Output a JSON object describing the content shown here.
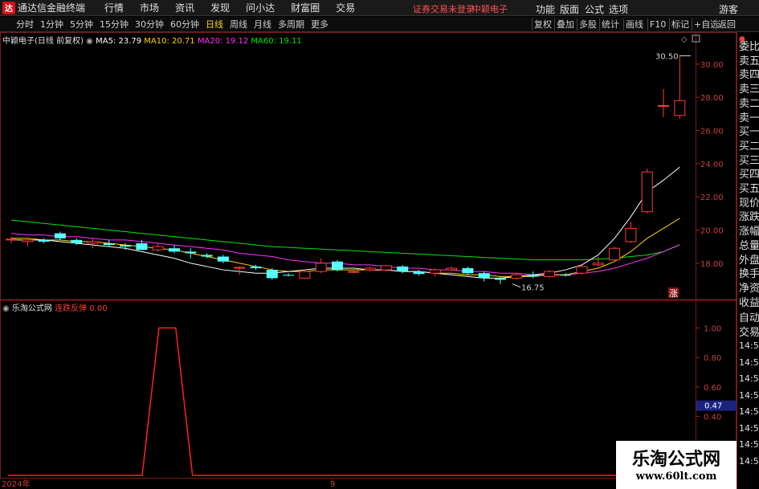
{
  "app_title": "通达信金融终端",
  "menus": [
    "行情",
    "市场",
    "资讯",
    "发现",
    "问小达",
    "财富圈",
    "交易"
  ],
  "login_warning": "证券交易未登录",
  "stock_name_top": "中颖电子",
  "right_menus": [
    "功能",
    "版面",
    "公式",
    "选项",
    "游客"
  ],
  "toolbar": {
    "periods": [
      "分时",
      "1分钟",
      "5分钟",
      "15分钟",
      "30分钟",
      "60分钟",
      "日线",
      "周线",
      "月线",
      "多周期",
      "更多"
    ],
    "active": "日线",
    "right_buttons": [
      "复权",
      "叠加",
      "多股",
      "统计",
      "画线",
      "F10",
      "标记",
      "+自选",
      "返回"
    ]
  },
  "main_legend": {
    "title": "中颖电子(日线 前复权)",
    "ma5": "MA5: 23.79",
    "ma10": "MA10: 20.71",
    "ma20": "MA20: 19.12",
    "ma60": "MA60: 19.11"
  },
  "sub_legend": {
    "title": "乐淘公式网",
    "indicator": "连跌反弹",
    "value": "0.00"
  },
  "annotations": {
    "high": "30.50",
    "low": "16.75",
    "rise_badge": "涨"
  },
  "right_panel": {
    "labels": [
      "委比",
      "卖五",
      "卖四",
      "卖三",
      "卖二",
      "卖一",
      "买一",
      "买二",
      "买三",
      "买四",
      "买五",
      "现价",
      "涨跌",
      "涨幅",
      "总量",
      "外盘",
      "换手",
      "净资",
      "收益",
      "自动",
      "交易"
    ],
    "times": [
      "14:56",
      "14:56",
      "14:56",
      "14:56",
      "14:56",
      "14:56",
      "14:56",
      "14:56"
    ]
  },
  "time_axis": [
    "2024年",
    "9"
  ],
  "sub_value_tag": "0.47",
  "watermark": {
    "line1": "乐淘公式网",
    "line2": "www.60lt.com"
  },
  "colors": {
    "up": "#ff3c3c",
    "down": "#54ffff",
    "ma5": "#ffffff",
    "ma10": "#ffd200",
    "ma20": "#ff32ff",
    "ma60": "#00e600",
    "indicator": "#ff2020"
  },
  "chart_data": [
    {
      "type": "candlestick",
      "y_ticks": [
        18.0,
        20.0,
        22.0,
        24.0,
        26.0,
        28.0,
        30.0
      ],
      "ylim": [
        16.2,
        31.2
      ],
      "candles": [
        {
          "o": 19.4,
          "h": 19.6,
          "l": 19.2,
          "c": 19.45
        },
        {
          "o": 19.3,
          "h": 19.55,
          "l": 19.0,
          "c": 19.4
        },
        {
          "o": 19.4,
          "h": 19.5,
          "l": 19.2,
          "c": 19.3
        },
        {
          "o": 19.8,
          "h": 19.9,
          "l": 19.4,
          "c": 19.5
        },
        {
          "o": 19.4,
          "h": 19.5,
          "l": 19.1,
          "c": 19.2
        },
        {
          "o": 19.2,
          "h": 19.5,
          "l": 18.9,
          "c": 19.3
        },
        {
          "o": 19.2,
          "h": 19.4,
          "l": 19.0,
          "c": 19.1
        },
        {
          "o": 19.1,
          "h": 19.2,
          "l": 18.8,
          "c": 19.0
        },
        {
          "o": 19.2,
          "h": 19.4,
          "l": 18.9,
          "c": 18.8
        },
        {
          "o": 18.8,
          "h": 19.2,
          "l": 18.7,
          "c": 19.0
        },
        {
          "o": 18.9,
          "h": 19.1,
          "l": 18.6,
          "c": 18.7
        },
        {
          "o": 18.7,
          "h": 18.9,
          "l": 18.3,
          "c": 18.6
        },
        {
          "o": 18.5,
          "h": 18.6,
          "l": 18.3,
          "c": 18.4
        },
        {
          "o": 18.4,
          "h": 18.5,
          "l": 18.0,
          "c": 18.1
        },
        {
          "o": 17.7,
          "h": 17.8,
          "l": 17.3,
          "c": 17.75
        },
        {
          "o": 17.8,
          "h": 17.9,
          "l": 17.6,
          "c": 17.7
        },
        {
          "o": 17.6,
          "h": 17.7,
          "l": 17.0,
          "c": 17.1
        },
        {
          "o": 17.3,
          "h": 17.4,
          "l": 17.2,
          "c": 17.25
        },
        {
          "o": 17.1,
          "h": 17.6,
          "l": 17.05,
          "c": 17.5
        },
        {
          "o": 17.5,
          "h": 18.3,
          "l": 17.4,
          "c": 18.0
        },
        {
          "o": 18.1,
          "h": 18.2,
          "l": 17.5,
          "c": 17.6
        },
        {
          "o": 17.5,
          "h": 17.6,
          "l": 17.4,
          "c": 17.5
        },
        {
          "o": 17.6,
          "h": 17.8,
          "l": 17.5,
          "c": 17.7
        },
        {
          "o": 17.6,
          "h": 17.9,
          "l": 17.5,
          "c": 17.85
        },
        {
          "o": 17.8,
          "h": 17.9,
          "l": 17.4,
          "c": 17.5
        },
        {
          "o": 17.5,
          "h": 17.6,
          "l": 17.25,
          "c": 17.35
        },
        {
          "o": 17.4,
          "h": 17.7,
          "l": 17.2,
          "c": 17.6
        },
        {
          "o": 17.6,
          "h": 17.8,
          "l": 17.5,
          "c": 17.7
        },
        {
          "o": 17.7,
          "h": 17.8,
          "l": 17.3,
          "c": 17.4
        },
        {
          "o": 17.4,
          "h": 17.5,
          "l": 16.9,
          "c": 17.1
        },
        {
          "o": 17.1,
          "h": 17.2,
          "l": 16.75,
          "c": 17.0
        },
        {
          "o": 17.1,
          "h": 17.4,
          "l": 17.0,
          "c": 17.3
        },
        {
          "o": 17.3,
          "h": 17.5,
          "l": 17.1,
          "c": 17.2
        },
        {
          "o": 17.2,
          "h": 17.6,
          "l": 17.1,
          "c": 17.5
        },
        {
          "o": 17.3,
          "h": 17.4,
          "l": 17.2,
          "c": 17.25
        },
        {
          "o": 17.4,
          "h": 17.9,
          "l": 17.3,
          "c": 17.8
        },
        {
          "o": 17.9,
          "h": 18.4,
          "l": 17.8,
          "c": 18.0
        },
        {
          "o": 18.2,
          "h": 19.0,
          "l": 18.1,
          "c": 18.9
        },
        {
          "o": 19.3,
          "h": 20.5,
          "l": 19.2,
          "c": 20.1
        },
        {
          "o": 21.1,
          "h": 23.7,
          "l": 21.0,
          "c": 23.5
        },
        {
          "o": 27.5,
          "h": 28.5,
          "l": 26.8,
          "c": 27.5
        },
        {
          "o": 26.9,
          "h": 30.5,
          "l": 26.7,
          "c": 27.8
        }
      ],
      "ma60": [
        20.6,
        20.5,
        20.4,
        20.3,
        20.2,
        20.1,
        20.0,
        19.9,
        19.8,
        19.7,
        19.6,
        19.5,
        19.4,
        19.3,
        19.2,
        19.1,
        19.0,
        18.95,
        18.9,
        18.85,
        18.8,
        18.75,
        18.7,
        18.65,
        18.6,
        18.55,
        18.5,
        18.45,
        18.4,
        18.35,
        18.3,
        18.25,
        18.2,
        18.2,
        18.2,
        18.2,
        18.25,
        18.3,
        18.4,
        18.5,
        18.7,
        19.11
      ],
      "ma20": [
        19.8,
        19.7,
        19.7,
        19.6,
        19.6,
        19.5,
        19.4,
        19.4,
        19.3,
        19.2,
        19.1,
        19.0,
        18.9,
        18.8,
        18.6,
        18.5,
        18.4,
        18.2,
        18.1,
        18.0,
        18.0,
        17.9,
        17.9,
        17.8,
        17.7,
        17.7,
        17.6,
        17.6,
        17.5,
        17.5,
        17.4,
        17.4,
        17.3,
        17.3,
        17.3,
        17.4,
        17.5,
        17.7,
        18.0,
        18.3,
        18.7,
        19.12
      ],
      "ma10": [
        19.5,
        19.5,
        19.4,
        19.4,
        19.3,
        19.3,
        19.2,
        19.1,
        19.0,
        18.9,
        18.8,
        18.6,
        18.4,
        18.2,
        18.0,
        17.8,
        17.6,
        17.5,
        17.5,
        17.6,
        17.6,
        17.6,
        17.6,
        17.6,
        17.5,
        17.5,
        17.4,
        17.4,
        17.3,
        17.3,
        17.2,
        17.2,
        17.2,
        17.3,
        17.3,
        17.5,
        17.7,
        18.1,
        18.7,
        19.5,
        20.1,
        20.71
      ],
      "ma5": [
        19.4,
        19.4,
        19.4,
        19.3,
        19.2,
        19.1,
        19.0,
        18.9,
        18.7,
        18.5,
        18.3,
        18.0,
        17.8,
        17.6,
        17.5,
        17.4,
        17.4,
        17.5,
        17.6,
        17.7,
        17.7,
        17.7,
        17.6,
        17.6,
        17.5,
        17.5,
        17.4,
        17.3,
        17.2,
        17.1,
        17.1,
        17.2,
        17.3,
        17.4,
        17.6,
        17.9,
        18.5,
        19.5,
        20.8,
        22.3,
        23.0,
        23.79
      ]
    },
    {
      "type": "line",
      "y_ticks": [
        0.0,
        0.2,
        0.4,
        0.6,
        0.8,
        1.0
      ],
      "ylim": [
        0,
        1.1
      ],
      "series": [
        {
          "name": "连跌反弹",
          "values": [
            0,
            0,
            0,
            0,
            0,
            0,
            0,
            0,
            0,
            1,
            1,
            0,
            0,
            0,
            0,
            0,
            0,
            0,
            0,
            0,
            0,
            0,
            0,
            0,
            0,
            0,
            0,
            0,
            0,
            0,
            0,
            0,
            0,
            0,
            0,
            0,
            0,
            0,
            0,
            0,
            0,
            0
          ]
        }
      ]
    }
  ]
}
